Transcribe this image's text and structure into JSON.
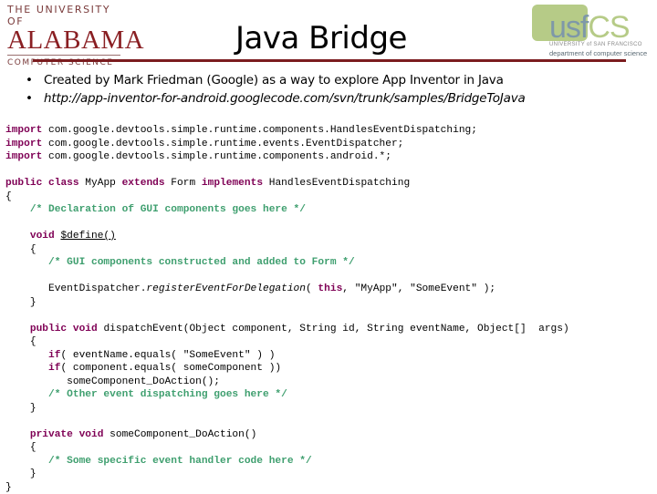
{
  "header": {
    "left_logo": {
      "top_line": "THE UNIVERSITY OF",
      "main": "ALABAMA",
      "sub": "COMPUTER SCIENCE"
    },
    "right_logo": {
      "usf": "usf",
      "cs": "CS",
      "line1": "UNIVERSITY of SAN FRANCISCO",
      "line2": "department of computer science"
    },
    "title": "Java Bridge"
  },
  "colors": {
    "rule": "#7b1c1f",
    "keyword": "#7f0055",
    "comment": "#3f9f6f",
    "usf_green": "#b6cb87",
    "usf_blue": "#7e98a8"
  },
  "bullets": [
    "Created by Mark Friedman (Google) as a way to explore App Inventor in Java",
    "http://app-inventor-for-android.googlecode.com/svn/trunk/samples/BridgeToJava"
  ],
  "code": {
    "imports": [
      {
        "kw": "import",
        "text": " com.google.devtools.simple.runtime.components.HandlesEventDispatching;"
      },
      {
        "kw": "import",
        "text": " com.google.devtools.simple.runtime.events.EventDispatcher;"
      },
      {
        "kw": "import",
        "text": " com.google.devtools.simple.runtime.components.android.*;"
      }
    ],
    "class_decl": {
      "kw1": "public",
      "kw2": "class",
      "name": " MyApp ",
      "kw3": "extends",
      "base": " Form ",
      "kw4": "implements",
      "iface": " HandlesEventDispatching"
    },
    "open_brace": "{",
    "close_brace": "}",
    "comment_decl": "/* Declaration of GUI components goes here */",
    "define": {
      "kw": "void",
      "name": "$define()",
      "comment": "/* GUI components constructed and added to Form */",
      "call_obj": "EventDispatcher.",
      "call_method": "registerEventForDelegation",
      "call_open": "( ",
      "call_kw": "this",
      "call_args": ", \"MyApp\", \"SomeEvent\" );"
    },
    "dispatch": {
      "kw1": "public",
      "kw2": "void",
      "sig": " dispatchEvent(Object component, String id, String eventName, Object[]  args)",
      "if_kw": "if",
      "if1": "( eventName.equals( \"SomeEvent\" ) )",
      "if2": "( component.equals( someComponent ))",
      "call": "someComponent_DoAction();",
      "comment": "/* Other event dispatching goes here */"
    },
    "action": {
      "kw1": "private",
      "kw2": "void",
      "sig": " someComponent_DoAction()",
      "comment": "/* Some specific event handler code here */"
    }
  }
}
